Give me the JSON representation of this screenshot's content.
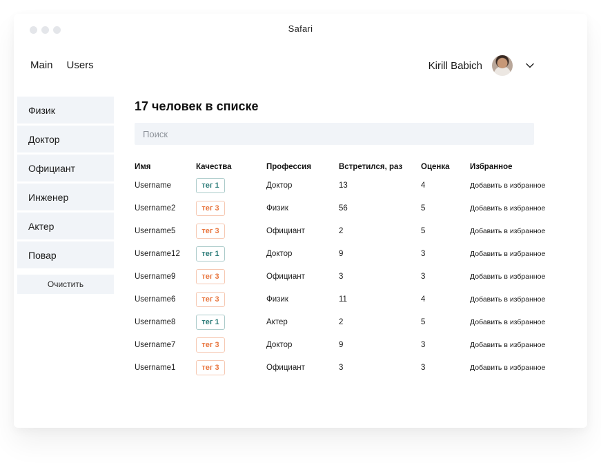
{
  "window": {
    "title": "Safari"
  },
  "nav": {
    "items": [
      "Main",
      "Users"
    ]
  },
  "user": {
    "name": "Kirill Babich"
  },
  "sidebar": {
    "items": [
      "Физик",
      "Доктор",
      "Официант",
      "Инженер",
      "Актер",
      "Повар"
    ],
    "clear_label": "Очистить"
  },
  "main": {
    "heading": "17 человек в списке",
    "search_placeholder": "Поиск",
    "columns": [
      "Имя",
      "Качества",
      "Профессия",
      "Встретился, раз",
      "Оценка",
      "Избранное"
    ],
    "rows": [
      {
        "name": "Username",
        "tag": "тег 1",
        "tag_type": "teal",
        "profession": "Доктор",
        "met": "13",
        "rating": "4",
        "fav": "Добавить в избранное"
      },
      {
        "name": "Username2",
        "tag": "тег 3",
        "tag_type": "orange",
        "profession": "Физик",
        "met": "56",
        "rating": "5",
        "fav": "Добавить в избранное"
      },
      {
        "name": "Username5",
        "tag": "тег 3",
        "tag_type": "orange",
        "profession": "Официант",
        "met": "2",
        "rating": "5",
        "fav": "Добавить в избранное"
      },
      {
        "name": "Username12",
        "tag": "тег 1",
        "tag_type": "teal",
        "profession": "Доктор",
        "met": "9",
        "rating": "3",
        "fav": "Добавить в избранное"
      },
      {
        "name": "Username9",
        "tag": "тег 3",
        "tag_type": "orange",
        "profession": "Официант",
        "met": "3",
        "rating": "3",
        "fav": "Добавить в избранное"
      },
      {
        "name": "Username6",
        "tag": "тег 3",
        "tag_type": "orange",
        "profession": "Физик",
        "met": "11",
        "rating": "4",
        "fav": "Добавить в избранное"
      },
      {
        "name": "Username8",
        "tag": "тег 1",
        "tag_type": "teal",
        "profession": "Актер",
        "met": "2",
        "rating": "5",
        "fav": "Добавить в избранное"
      },
      {
        "name": "Username7",
        "tag": "тег 3",
        "tag_type": "orange",
        "profession": "Доктор",
        "met": "9",
        "rating": "3",
        "fav": "Добавить в избранное"
      },
      {
        "name": "Username1",
        "tag": "тег 3",
        "tag_type": "orange",
        "profession": "Официант",
        "met": "3",
        "rating": "3",
        "fav": "Добавить в избранное"
      }
    ]
  },
  "colors": {
    "teal_tag": "#2e7d7a",
    "orange_tag": "#e8763f",
    "panel_bg": "#f1f4f8"
  },
  "icons": {
    "window_controls": "traffic-light-dots",
    "user_menu": "chevron-down-icon",
    "avatar": "user-avatar"
  }
}
